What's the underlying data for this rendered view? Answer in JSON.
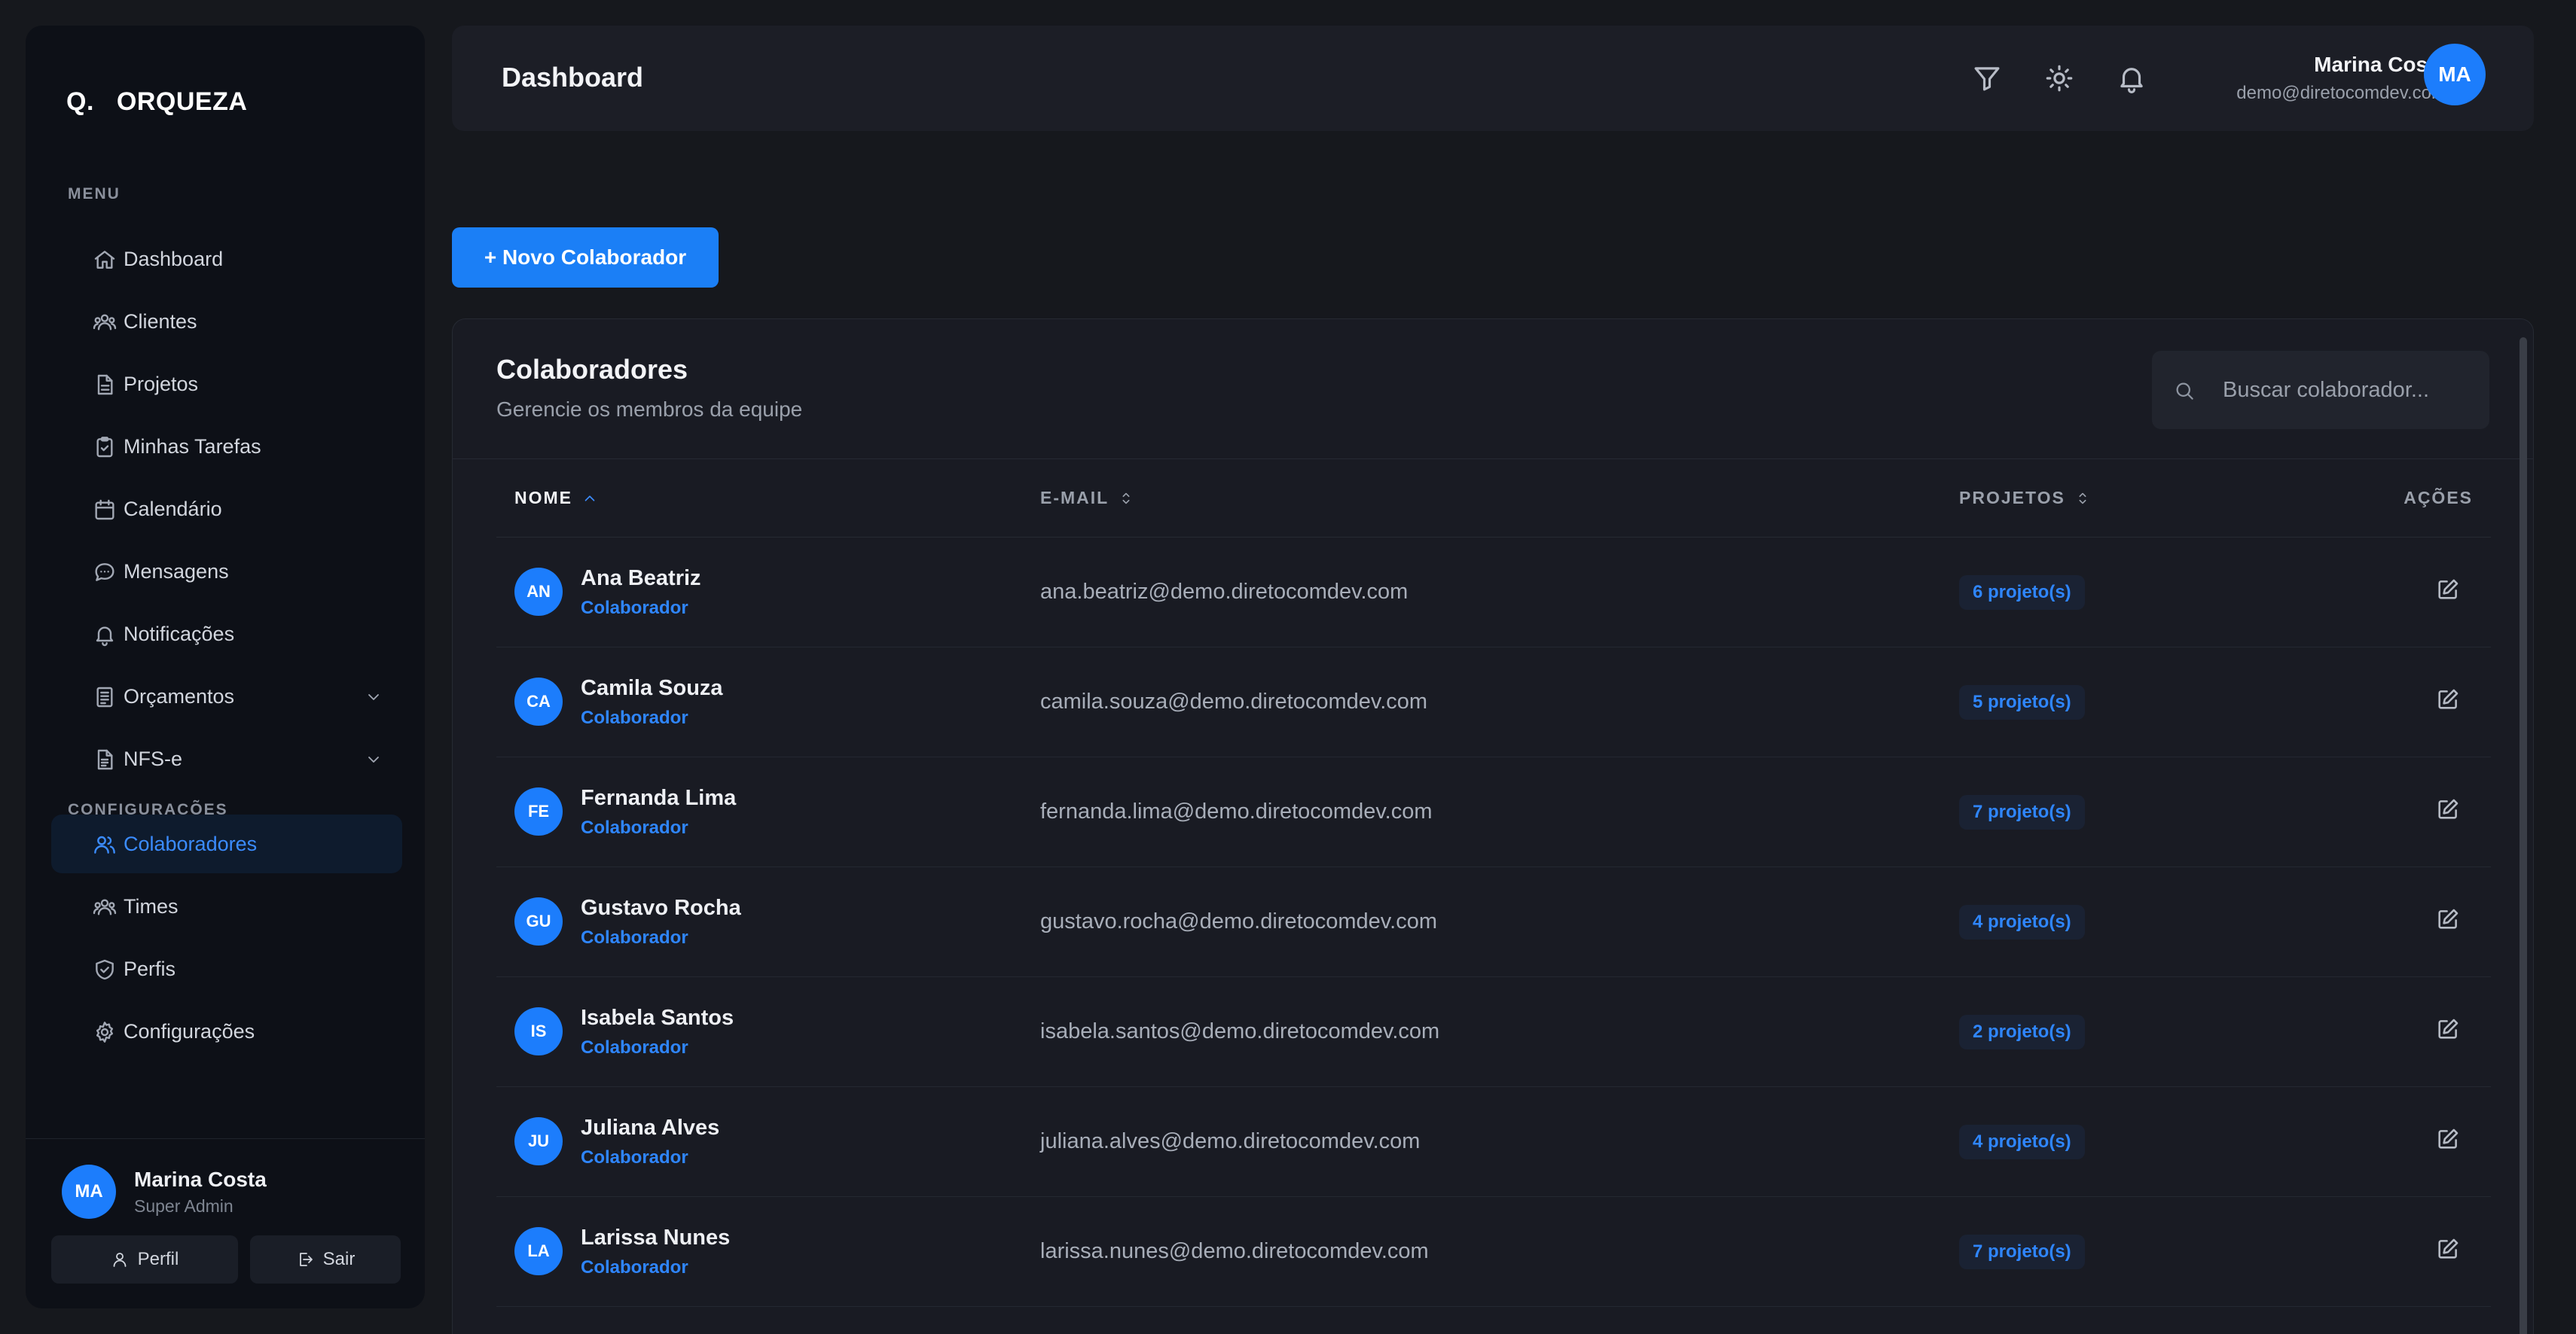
{
  "brand": {
    "mark": "Q.",
    "name": "ORQUEZA"
  },
  "sidebar": {
    "menu_label": "MENU",
    "settings_label": "CONFIGURAÇÕES",
    "items": [
      {
        "label": "Dashboard",
        "icon": "home-icon"
      },
      {
        "label": "Clientes",
        "icon": "users-icon"
      },
      {
        "label": "Projetos",
        "icon": "file-icon"
      },
      {
        "label": "Minhas Tarefas",
        "icon": "clipboard-check-icon"
      },
      {
        "label": "Calendário",
        "icon": "calendar-icon"
      },
      {
        "label": "Mensagens",
        "icon": "message-icon"
      },
      {
        "label": "Notificações",
        "icon": "bell-icon"
      },
      {
        "label": "Orçamentos",
        "icon": "receipt-icon",
        "expandable": true
      },
      {
        "label": "NFS-e",
        "icon": "document-icon",
        "expandable": true
      }
    ],
    "settings_items": [
      {
        "label": "Colaboradores",
        "icon": "user-group-icon",
        "active": true
      },
      {
        "label": "Times",
        "icon": "team-icon"
      },
      {
        "label": "Perfis",
        "icon": "shield-check-icon"
      },
      {
        "label": "Configurações",
        "icon": "gear-icon"
      }
    ],
    "footer": {
      "avatar_initials": "MA",
      "name": "Marina Costa",
      "role": "Super Admin",
      "profile_button": "Perfil",
      "logout_button": "Sair"
    }
  },
  "header": {
    "title": "Dashboard",
    "icons": [
      "filter-icon",
      "sun-icon",
      "bell-icon"
    ],
    "user": {
      "name": "Marina Costa",
      "email": "demo@diretocomdev.com",
      "initials": "MA"
    }
  },
  "main": {
    "new_button": "+ Novo Colaborador",
    "card": {
      "title": "Colaboradores",
      "subtitle": "Gerencie os membros da equipe",
      "search_placeholder": "Buscar colaborador..."
    },
    "table": {
      "columns": [
        "NOME",
        "E-MAIL",
        "PROJETOS",
        "AÇÕES"
      ],
      "sorted_column": "NOME",
      "sort_direction": "asc",
      "rows": [
        {
          "initials": "AN",
          "name": "Ana Beatriz",
          "role": "Colaborador",
          "email": "ana.beatriz@demo.diretocomdev.com",
          "projects": "6 projeto(s)"
        },
        {
          "initials": "CA",
          "name": "Camila Souza",
          "role": "Colaborador",
          "email": "camila.souza@demo.diretocomdev.com",
          "projects": "5 projeto(s)"
        },
        {
          "initials": "FE",
          "name": "Fernanda Lima",
          "role": "Colaborador",
          "email": "fernanda.lima@demo.diretocomdev.com",
          "projects": "7 projeto(s)"
        },
        {
          "initials": "GU",
          "name": "Gustavo Rocha",
          "role": "Colaborador",
          "email": "gustavo.rocha@demo.diretocomdev.com",
          "projects": "4 projeto(s)"
        },
        {
          "initials": "IS",
          "name": "Isabela Santos",
          "role": "Colaborador",
          "email": "isabela.santos@demo.diretocomdev.com",
          "projects": "2 projeto(s)"
        },
        {
          "initials": "JU",
          "name": "Juliana Alves",
          "role": "Colaborador",
          "email": "juliana.alves@demo.diretocomdev.com",
          "projects": "4 projeto(s)"
        },
        {
          "initials": "LA",
          "name": "Larissa Nunes",
          "role": "Colaborador",
          "email": "larissa.nunes@demo.diretocomdev.com",
          "projects": "7 projeto(s)"
        }
      ]
    }
  },
  "colors": {
    "accent": "#1c7dfc",
    "background": "#16181d",
    "sidebar": "#0d1017",
    "card": "#191b23"
  }
}
